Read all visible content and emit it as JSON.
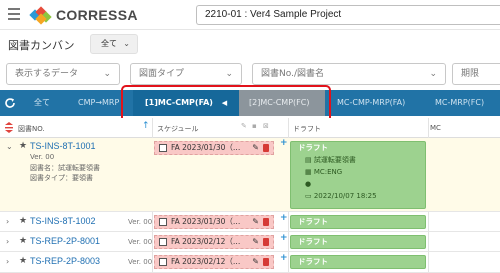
{
  "header": {
    "logo_text": "CORRESSA",
    "project": "2210-01 : Ver4 Sample Project"
  },
  "title_row": {
    "page_title": "図書カンバン",
    "filter_value": "全て"
  },
  "filters": {
    "display_data": "表示するデータ",
    "drawing_type": "図面タイプ",
    "drawing_no": "図書No./図書名",
    "deadline": "期限"
  },
  "tabs": [
    {
      "label": "全て"
    },
    {
      "label": "CMP→MRP"
    },
    {
      "label": "[1]MC-CMP(FA)"
    },
    {
      "label": "[2]MC-CMP(FC)"
    },
    {
      "label": "MC-CMP-MRP(FA)"
    },
    {
      "label": "MC-MRP(FC)"
    }
  ],
  "columns": {
    "docno": "図書NO.",
    "schedule": "スケジュール",
    "draft": "ドラフト",
    "mc": "MC"
  },
  "rows": [
    {
      "docno": "TS-INS-8T-1001",
      "ver": "Ver. 00",
      "name": "図書名：試運転要領書",
      "type": "図書タイプ：要領書",
      "schedule": "FA 2023/01/30（…",
      "draft_title": "ドラフト",
      "draft_doc": "試運転要領書",
      "draft_org": "MC:ENG",
      "draft_date": "2022/10/07 18:25"
    },
    {
      "docno": "TS-INS-8T-1002",
      "ver": "Ver. 00",
      "schedule": "FA 2023/01/30（…",
      "draft_title": "ドラフト"
    },
    {
      "docno": "TS-REP-2P-8001",
      "ver": "Ver. 00",
      "schedule": "FA 2023/02/12（…",
      "draft_title": "ドラフト"
    },
    {
      "docno": "TS-REP-2P-8003",
      "ver": "Ver. 00",
      "schedule": "FA 2023/02/12（…",
      "draft_title": "ドラフト"
    }
  ],
  "icons": {
    "menu": "hamburger-icon",
    "refresh": "refresh-icon",
    "sort": "sort-icon",
    "star": "star-icon",
    "pencil": "pencil-icon",
    "trash": "trash-icon",
    "plus": "plus-icon",
    "doc": "document-icon",
    "building": "building-icon",
    "user": "user-icon",
    "calendar": "calendar-icon"
  },
  "colors": {
    "tab_bar": "#2173a6",
    "schedule_card": "#f9c8c6",
    "draft_card": "#9dd28f",
    "highlight": "#e1121b",
    "expanded_row": "#fffbe8"
  }
}
